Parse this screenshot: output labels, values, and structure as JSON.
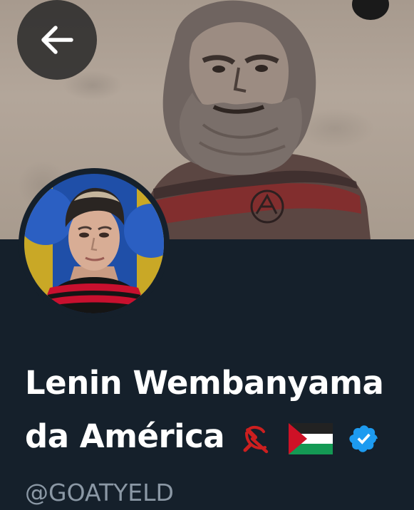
{
  "profile": {
    "display_name_line1": "Lenin Wembanyama",
    "display_name_line2": "da América",
    "handle": "@GOATYELD",
    "badges": [
      "hammer-sickle-icon",
      "palestine-flag-icon",
      "verified-badge-icon"
    ],
    "verified_color": "#1d9bf0"
  },
  "banner": {
    "description": "mural portrait"
  },
  "navigation": {
    "back_icon": "arrow-left-icon"
  },
  "colors": {
    "background": "#15202b",
    "handle": "#8b98a5",
    "name": "#ffffff"
  }
}
